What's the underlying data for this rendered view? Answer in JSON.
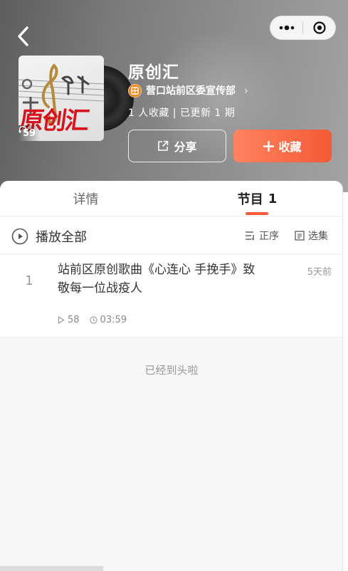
{
  "header": {
    "title": "原创汇",
    "author": "营口站前区委宣传部",
    "stats": "1 人收藏 | 已更新 1 期",
    "cover_play_count": "59",
    "cover_text": "原创汇",
    "share_label": "分享",
    "favorite_label": "收藏",
    "icons": [
      "back-icon",
      "more-icon",
      "close-icon",
      "headphones-icon",
      "share-icon",
      "plus-icon",
      "chevron-right-icon"
    ]
  },
  "tabs": [
    {
      "label": "详情",
      "count": ""
    },
    {
      "label": "节目",
      "count": "1"
    }
  ],
  "toolbar": {
    "play_all": "播放全部",
    "sort": "正序",
    "select": "选集"
  },
  "episodes": [
    {
      "index": "1",
      "title": "站前区原创歌曲《心连心 手挽手》致敬每一位战疫人",
      "date": "5天前",
      "plays": "58",
      "duration": "03:59"
    }
  ],
  "end_note": "已经到头啦",
  "colors": {
    "accent": "#f35a36",
    "accent_light": "#ff8360",
    "header_bg": "#7a7a7a"
  }
}
